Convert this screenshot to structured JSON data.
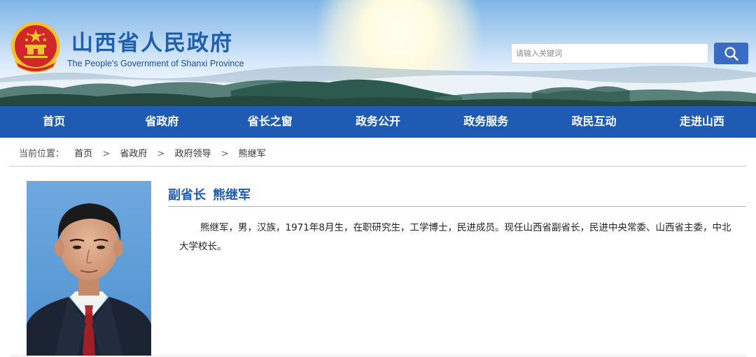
{
  "header": {
    "title": "山西省人民政府",
    "subtitle": "The People's Government of Shanxi Province",
    "emblem_icon": "national-emblem-icon",
    "search": {
      "placeholder": "请输入关键词",
      "button_icon": "search-icon"
    }
  },
  "nav": {
    "items": [
      {
        "label": "首页"
      },
      {
        "label": "省政府"
      },
      {
        "label": "省长之窗"
      },
      {
        "label": "政务公开"
      },
      {
        "label": "政务服务"
      },
      {
        "label": "政民互动"
      },
      {
        "label": "走进山西"
      }
    ]
  },
  "breadcrumb": {
    "prefix": "当前位置：",
    "items": [
      {
        "label": "首页"
      },
      {
        "label": "省政府"
      },
      {
        "label": "政府领导"
      },
      {
        "label": "熊继军"
      }
    ],
    "separator": ">"
  },
  "leader": {
    "title": "副省长",
    "name": "熊继军",
    "bio": "熊继军，男，汉族，1971年8月生，在职研究生，工学博士，民进成员。现任山西省副省长，民进中央常委、山西省主委，中北大学校长。"
  },
  "colors": {
    "brand_blue": "#1f5bb3",
    "title_blue": "#1e5fae",
    "search_button": "#3b6cc4",
    "emblem_red": "#d1272a",
    "emblem_gold": "#f2c230"
  }
}
